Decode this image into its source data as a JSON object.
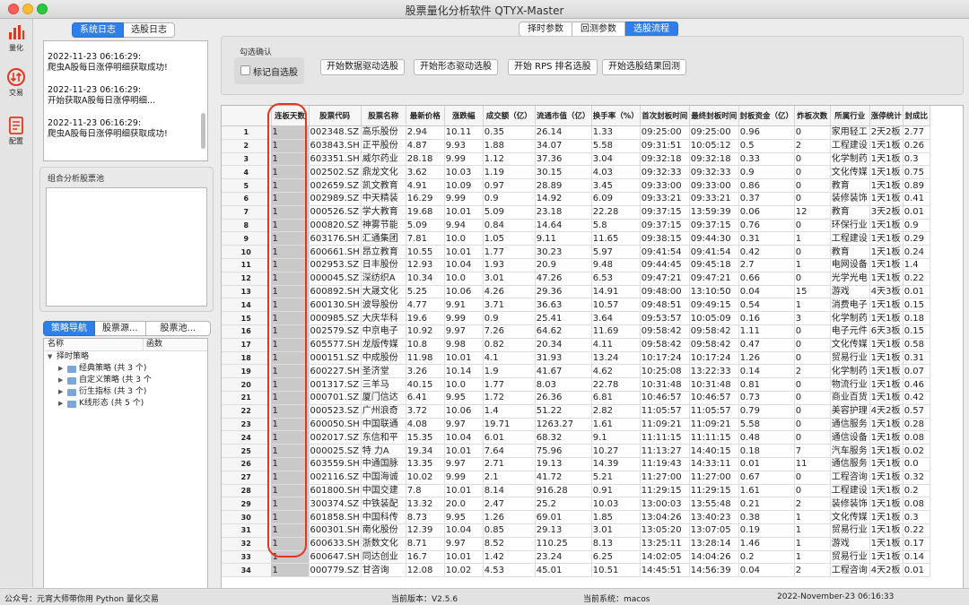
{
  "window": {
    "title": "股票量化分析软件 QTYX-Master"
  },
  "rail": [
    {
      "label": "量化",
      "icon": "bar-chart-icon",
      "color": "#e8341c"
    },
    {
      "label": "交易",
      "icon": "exchange-arrows-icon",
      "color": "#e8341c"
    },
    {
      "label": "配置",
      "icon": "document-config-icon",
      "color": "#e8341c"
    }
  ],
  "log": {
    "tabs": [
      "系统日志",
      "选股日志"
    ],
    "entries": [
      {
        "time": "2022-11-23 06:16:29:",
        "msg": "爬虫A股每日涨停明细获取成功!"
      },
      {
        "time": "2022-11-23 06:16:29:",
        "msg": "开始获取A股每日涨停明细..."
      },
      {
        "time": "2022-11-23 06:16:29:",
        "msg": "爬虫A股每日涨停明细获取成功!"
      }
    ]
  },
  "pool": {
    "title": "组合分析股票池"
  },
  "nav": {
    "tabs": [
      "策略导航",
      "股票源...",
      "股票池..."
    ],
    "tree_headers": [
      "名称",
      "函数"
    ],
    "root": "择时策略",
    "children": [
      "经典策略 (共 3 个)",
      "自定义策略 (共 3 个",
      "衍生指标 (共 3 个)",
      "K线形态 (共 5 个)"
    ]
  },
  "main_tabs": [
    "择时参数",
    "回测参数",
    "选股流程"
  ],
  "config": {
    "group_title": "勾选确认",
    "checkbox_label": "标记自选股",
    "buttons": [
      "开始数据驱动选股",
      "开始形态驱动选股",
      "开始 RPS 排名选股",
      "开始选股结果回测"
    ]
  },
  "table": {
    "headers": [
      "连板天数",
      "股票代码",
      "股票名称",
      "最新价格",
      "涨跌幅",
      "成交额（亿）",
      "流通市值（亿）",
      "换手率（%）",
      "首次封板时间",
      "最终封板时间",
      "封板资金（亿）",
      "炸板次数",
      "所属行业",
      "涨停统计",
      "封成比"
    ],
    "rows": [
      [
        "1",
        "002348.SZ",
        "高乐股份",
        "2.94",
        "10.11",
        "0.35",
        "26.14",
        "1.33",
        "09:25:00",
        "09:25:00",
        "0.96",
        "0",
        "家用轻工",
        "2天2板",
        "2.77"
      ],
      [
        "1",
        "603843.SH",
        "正平股份",
        "4.87",
        "9.93",
        "1.88",
        "34.07",
        "5.58",
        "09:31:51",
        "10:05:12",
        "0.5",
        "2",
        "工程建设",
        "1天1板",
        "0.26"
      ],
      [
        "1",
        "603351.SH",
        "威尔药业",
        "28.18",
        "9.99",
        "1.12",
        "37.36",
        "3.04",
        "09:32:18",
        "09:32:18",
        "0.33",
        "0",
        "化学制药",
        "1天1板",
        "0.3"
      ],
      [
        "1",
        "002502.SZ",
        "鼎龙文化",
        "3.62",
        "10.03",
        "1.19",
        "30.15",
        "4.03",
        "09:32:33",
        "09:32:33",
        "0.9",
        "0",
        "文化传媒",
        "1天1板",
        "0.75"
      ],
      [
        "1",
        "002659.SZ",
        "凯文教育",
        "4.91",
        "10.09",
        "0.97",
        "28.89",
        "3.45",
        "09:33:00",
        "09:33:00",
        "0.86",
        "0",
        "教育",
        "1天1板",
        "0.89"
      ],
      [
        "1",
        "002989.SZ",
        "中天精装",
        "16.29",
        "9.99",
        "0.9",
        "14.92",
        "6.09",
        "09:33:21",
        "09:33:21",
        "0.37",
        "0",
        "装修装饰",
        "1天1板",
        "0.41"
      ],
      [
        "1",
        "000526.SZ",
        "学大教育",
        "19.68",
        "10.01",
        "5.09",
        "23.18",
        "22.28",
        "09:37:15",
        "13:59:39",
        "0.06",
        "12",
        "教育",
        "3天2板",
        "0.01"
      ],
      [
        "1",
        "000820.SZ",
        "神雾节能",
        "5.09",
        "9.94",
        "0.84",
        "14.64",
        "5.8",
        "09:37:15",
        "09:37:15",
        "0.76",
        "0",
        "环保行业",
        "1天1板",
        "0.9"
      ],
      [
        "1",
        "603176.SH",
        "汇通集团",
        "7.81",
        "10.0",
        "1.05",
        "9.11",
        "11.65",
        "09:38:15",
        "09:44:30",
        "0.31",
        "1",
        "工程建设",
        "1天1板",
        "0.29"
      ],
      [
        "1",
        "600661.SH",
        "昂立教育",
        "10.55",
        "10.01",
        "1.77",
        "30.23",
        "5.97",
        "09:41:54",
        "09:41:54",
        "0.42",
        "0",
        "教育",
        "1天1板",
        "0.24"
      ],
      [
        "1",
        "002953.SZ",
        "日丰股份",
        "12.93",
        "10.04",
        "1.93",
        "20.9",
        "9.48",
        "09:44:45",
        "09:45:18",
        "2.7",
        "1",
        "电网设备",
        "1天1板",
        "1.4"
      ],
      [
        "1",
        "000045.SZ",
        "深纺织A",
        "10.34",
        "10.0",
        "3.01",
        "47.26",
        "6.53",
        "09:47:21",
        "09:47:21",
        "0.66",
        "0",
        "光学光电",
        "1天1板",
        "0.22"
      ],
      [
        "1",
        "600892.SH",
        "大晟文化",
        "5.25",
        "10.06",
        "4.26",
        "29.36",
        "14.91",
        "09:48:00",
        "13:10:50",
        "0.04",
        "15",
        "游戏",
        "4天3板",
        "0.01"
      ],
      [
        "1",
        "600130.SH",
        "波导股份",
        "4.77",
        "9.91",
        "3.71",
        "36.63",
        "10.57",
        "09:48:51",
        "09:49:15",
        "0.54",
        "1",
        "消费电子",
        "1天1板",
        "0.15"
      ],
      [
        "1",
        "000985.SZ",
        "大庆华科",
        "19.6",
        "9.99",
        "0.9",
        "25.41",
        "3.64",
        "09:53:57",
        "10:05:09",
        "0.16",
        "3",
        "化学制药",
        "1天1板",
        "0.18"
      ],
      [
        "1",
        "002579.SZ",
        "中京电子",
        "10.92",
        "9.97",
        "7.26",
        "64.62",
        "11.69",
        "09:58:42",
        "09:58:42",
        "1.11",
        "0",
        "电子元件",
        "6天3板",
        "0.15"
      ],
      [
        "1",
        "605577.SH",
        "龙版传媒",
        "10.8",
        "9.98",
        "0.82",
        "20.34",
        "4.11",
        "09:58:42",
        "09:58:42",
        "0.47",
        "0",
        "文化传媒",
        "1天1板",
        "0.58"
      ],
      [
        "1",
        "000151.SZ",
        "中成股份",
        "11.98",
        "10.01",
        "4.1",
        "31.93",
        "13.24",
        "10:17:24",
        "10:17:24",
        "1.26",
        "0",
        "贸易行业",
        "1天1板",
        "0.31"
      ],
      [
        "1",
        "600227.SH",
        "圣济堂",
        "3.26",
        "10.14",
        "1.9",
        "41.67",
        "4.62",
        "10:25:08",
        "13:22:33",
        "0.14",
        "2",
        "化学制药",
        "1天1板",
        "0.07"
      ],
      [
        "1",
        "001317.SZ",
        "三羊马",
        "40.15",
        "10.0",
        "1.77",
        "8.03",
        "22.78",
        "10:31:48",
        "10:31:48",
        "0.81",
        "0",
        "物流行业",
        "1天1板",
        "0.46"
      ],
      [
        "1",
        "000701.SZ",
        "厦门信达",
        "6.41",
        "9.95",
        "1.72",
        "26.36",
        "6.81",
        "10:46:57",
        "10:46:57",
        "0.73",
        "0",
        "商业百货",
        "1天1板",
        "0.42"
      ],
      [
        "1",
        "000523.SZ",
        "广州浪奇",
        "3.72",
        "10.06",
        "1.4",
        "51.22",
        "2.82",
        "11:05:57",
        "11:05:57",
        "0.79",
        "0",
        "美容护理",
        "4天2板",
        "0.57"
      ],
      [
        "1",
        "600050.SH",
        "中国联通",
        "4.08",
        "9.97",
        "19.71",
        "1263.27",
        "1.61",
        "11:09:21",
        "11:09:21",
        "5.58",
        "0",
        "通信服务",
        "1天1板",
        "0.28"
      ],
      [
        "1",
        "002017.SZ",
        "东信和平",
        "15.35",
        "10.04",
        "6.01",
        "68.32",
        "9.1",
        "11:11:15",
        "11:11:15",
        "0.48",
        "0",
        "通信设备",
        "1天1板",
        "0.08"
      ],
      [
        "1",
        "000025.SZ",
        "特 力A",
        "19.34",
        "10.01",
        "7.64",
        "75.96",
        "10.27",
        "11:13:27",
        "14:40:15",
        "0.18",
        "7",
        "汽车服务",
        "1天1板",
        "0.02"
      ],
      [
        "1",
        "603559.SH",
        "中通国脉",
        "13.35",
        "9.97",
        "2.71",
        "19.13",
        "14.39",
        "11:19:43",
        "14:33:11",
        "0.01",
        "11",
        "通信服务",
        "1天1板",
        "0.0"
      ],
      [
        "1",
        "002116.SZ",
        "中国海诚",
        "10.02",
        "9.99",
        "2.1",
        "41.72",
        "5.21",
        "11:27:00",
        "11:27:00",
        "0.67",
        "0",
        "工程咨询",
        "1天1板",
        "0.32"
      ],
      [
        "1",
        "601800.SH",
        "中国交建",
        "7.8",
        "10.01",
        "8.14",
        "916.28",
        "0.91",
        "11:29:15",
        "11:29:15",
        "1.61",
        "0",
        "工程建设",
        "1天1板",
        "0.2"
      ],
      [
        "1",
        "300374.SZ",
        "中铁装配",
        "13.32",
        "20.0",
        "2.47",
        "25.2",
        "10.03",
        "13:00:03",
        "13:55:48",
        "0.21",
        "2",
        "装修装饰",
        "1天1板",
        "0.08"
      ],
      [
        "1",
        "601858.SH",
        "中国科传",
        "8.73",
        "9.95",
        "1.26",
        "69.01",
        "1.85",
        "13:04:26",
        "13:40:23",
        "0.38",
        "1",
        "文化传媒",
        "1天1板",
        "0.3"
      ],
      [
        "1",
        "600301.SH",
        "南化股份",
        "12.39",
        "10.04",
        "0.85",
        "29.13",
        "3.01",
        "13:05:20",
        "13:07:05",
        "0.19",
        "1",
        "贸易行业",
        "1天1板",
        "0.22"
      ],
      [
        "1",
        "600633.SH",
        "浙数文化",
        "8.71",
        "9.97",
        "8.52",
        "110.25",
        "8.13",
        "13:25:11",
        "13:28:14",
        "1.46",
        "1",
        "游戏",
        "1天1板",
        "0.17"
      ],
      [
        "1",
        "600647.SH",
        "同达创业",
        "16.7",
        "10.01",
        "1.42",
        "23.24",
        "6.25",
        "14:02:05",
        "14:04:26",
        "0.2",
        "1",
        "贸易行业",
        "1天1板",
        "0.14"
      ],
      [
        "1",
        "000779.SZ",
        "甘咨询",
        "12.08",
        "10.02",
        "4.53",
        "45.01",
        "10.51",
        "14:45:51",
        "14:56:39",
        "0.04",
        "2",
        "工程咨询",
        "4天2板",
        "0.01"
      ]
    ]
  },
  "status": {
    "left": "公众号：元宵大师带你用 Python 量化交易",
    "version": "当前版本：V2.5.6",
    "system": "当前系统：macos",
    "datetime": "2022-November-23 06:16:33"
  },
  "colors": {
    "accent": "#2f7fe8",
    "annotation": "#e8341c"
  }
}
